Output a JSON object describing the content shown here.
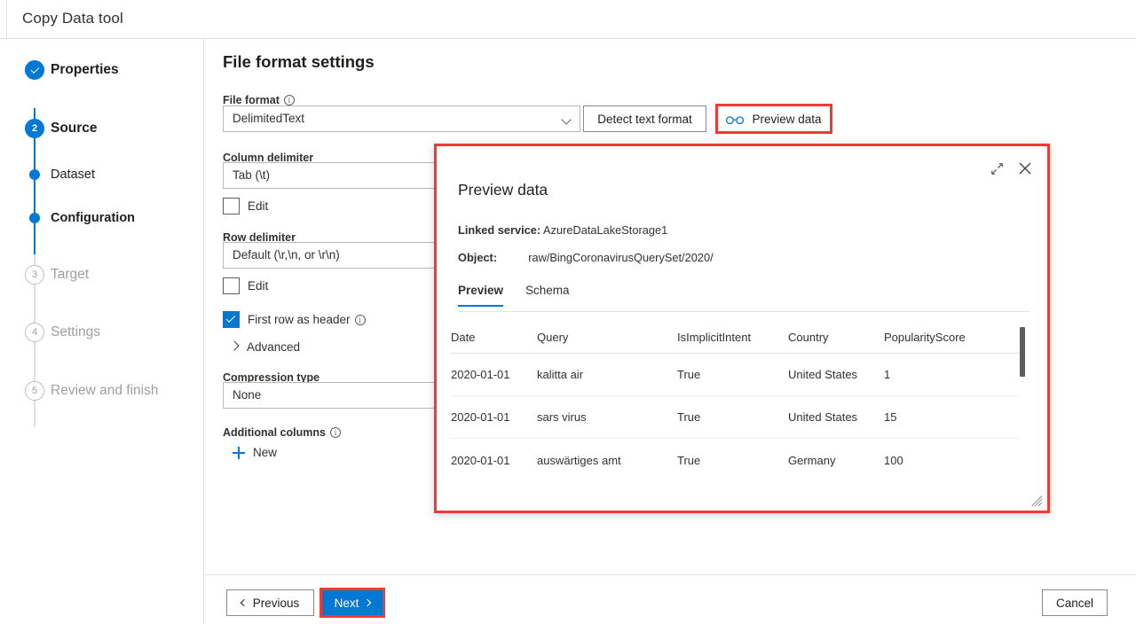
{
  "window": {
    "title": "Copy Data tool"
  },
  "stepper": {
    "items": [
      {
        "label": "Properties",
        "marker": "check",
        "state": "done"
      },
      {
        "label": "Source",
        "marker": "2",
        "state": "current"
      },
      {
        "label": "Dataset",
        "marker": "",
        "state": "substep"
      },
      {
        "label": "Configuration",
        "marker": "",
        "state": "substep"
      },
      {
        "label": "Target",
        "marker": "3",
        "state": "future"
      },
      {
        "label": "Settings",
        "marker": "4",
        "state": "future"
      },
      {
        "label": "Review and finish",
        "marker": "5",
        "state": "future"
      }
    ]
  },
  "main": {
    "page_title": "File format settings",
    "fields": {
      "file_format_label": "File format",
      "file_format_value": "DelimitedText",
      "column_delimiter_label": "Column delimiter",
      "column_delimiter_value": "Tab (\\t)",
      "column_delimiter_edit": "Edit",
      "row_delimiter_label": "Row delimiter",
      "row_delimiter_value": "Default (\\r,\\n, or \\r\\n)",
      "row_delimiter_edit": "Edit",
      "first_row_header_label": "First row as header",
      "advanced_label": "Advanced",
      "compression_label": "Compression type",
      "compression_value": "None",
      "additional_columns_label": "Additional columns",
      "new_label": "New"
    },
    "buttons": {
      "detect_text_format": "Detect text format",
      "preview_data": "Preview data"
    }
  },
  "dialog": {
    "title": "Preview data",
    "linked_service_key": "Linked service:",
    "linked_service_value": "AzureDataLakeStorage1",
    "object_key": "Object:",
    "object_value": "raw/BingCoronavirusQuerySet/2020/",
    "tabs": [
      {
        "label": "Preview",
        "active": true
      },
      {
        "label": "Schema",
        "active": false
      }
    ],
    "table": {
      "columns": [
        "Date",
        "Query",
        "IsImplicitIntent",
        "Country",
        "PopularityScore"
      ],
      "rows": [
        [
          "2020-01-01",
          "kalitta air",
          "True",
          "United States",
          "1"
        ],
        [
          "2020-01-01",
          "sars virus",
          "True",
          "United States",
          "15"
        ],
        [
          "2020-01-01",
          "auswärtiges amt",
          "True",
          "Germany",
          "100"
        ]
      ]
    }
  },
  "footer": {
    "previous": "Previous",
    "next": "Next",
    "cancel": "Cancel"
  },
  "colors": {
    "accent": "#0078d4",
    "highlight": "#ef3b36",
    "text": "#323130",
    "muted": "#a19f9d",
    "border": "#e6e4e2"
  }
}
